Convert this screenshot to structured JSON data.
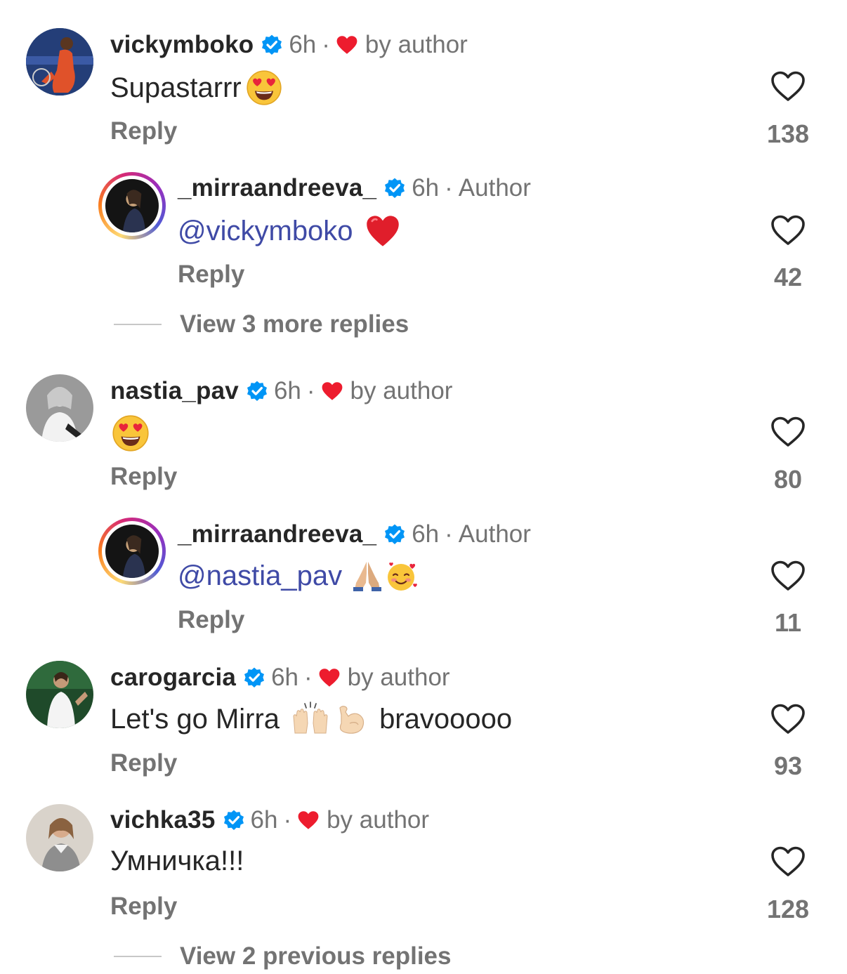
{
  "comments": [
    {
      "username": "vickymboko",
      "time": "6h",
      "dot": "·",
      "tag": "by author",
      "text": "Supastarrr",
      "reply": "Reply",
      "likes": "138"
    },
    {
      "username": "_mirraandreeva_",
      "time": "6h",
      "dot": "·",
      "tag": "Author",
      "text": "@vickymboko",
      "reply": "Reply",
      "likes": "42"
    },
    {
      "username": "nastia_pav",
      "time": "6h",
      "dot": "·",
      "tag": "by author",
      "text": "",
      "reply": "Reply",
      "likes": "80"
    },
    {
      "username": "_mirraandreeva_",
      "time": "6h",
      "dot": "·",
      "tag": "Author",
      "text": "@nastia_pav",
      "reply": "Reply",
      "likes": "11"
    },
    {
      "username": "carogarcia",
      "time": "6h",
      "dot": "·",
      "tag": "by author",
      "text": "Let's go Mirra",
      "text2": "bravooooo",
      "reply": "Reply",
      "likes": "93"
    },
    {
      "username": "vichka35",
      "time": "6h",
      "dot": "·",
      "tag": "by author",
      "text": "Умничка!!!",
      "reply": "Reply",
      "likes": "128"
    }
  ],
  "view_more_1": "View 3 more replies",
  "view_more_2": "View 2 previous replies",
  "colors": {
    "verified": "#0095f6",
    "heart_red": "#ed1c2e",
    "mention": "#3f4aa6",
    "muted": "#737373"
  },
  "icons": [
    "verified-badge-icon",
    "heart-icon",
    "like-heart-outline-icon",
    "heart-eyes-emoji",
    "red-heart-emoji",
    "folded-hands-emoji",
    "smiling-face-hearts-emoji",
    "raising-hands-emoji",
    "flexed-biceps-emoji"
  ]
}
